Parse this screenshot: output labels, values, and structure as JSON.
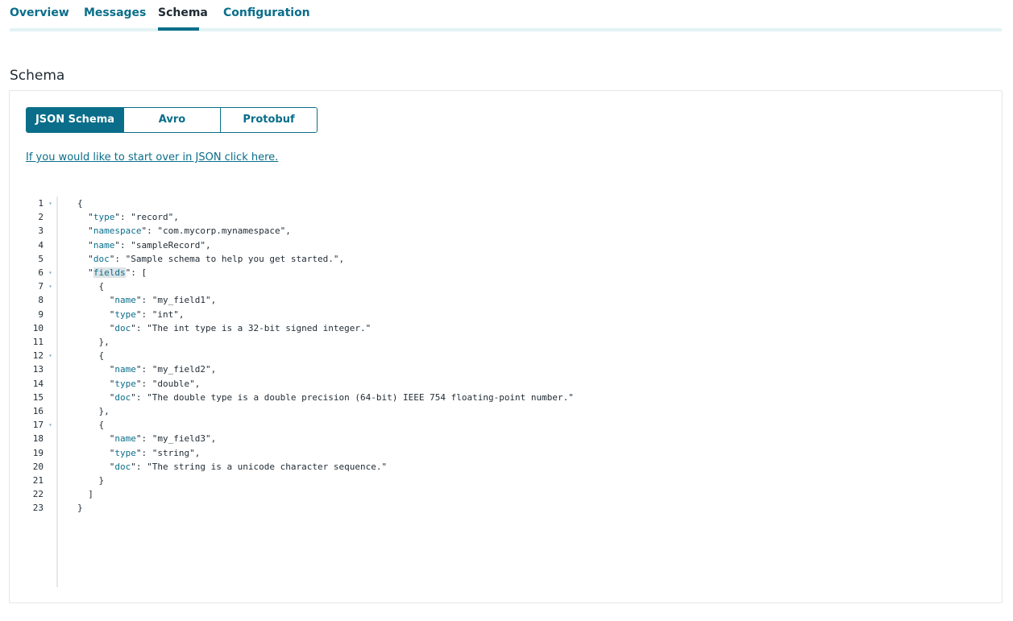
{
  "tabs": [
    {
      "label": "Overview"
    },
    {
      "label": "Messages"
    },
    {
      "label": "Schema"
    },
    {
      "label": "Configuration"
    }
  ],
  "page_title": "Schema",
  "schema_types": [
    {
      "label": "JSON Schema",
      "active": true
    },
    {
      "label": "Avro",
      "active": false
    },
    {
      "label": "Protobuf",
      "active": false
    }
  ],
  "start_over_link": "If you would like to start over in JSON click here.",
  "colors": {
    "accent": "#0a6e8a",
    "tab_rail": "#e3f3f4"
  },
  "editor": {
    "lines": [
      {
        "n": "1",
        "fold": true,
        "pre": "{",
        "key": "",
        "post": ""
      },
      {
        "n": "2",
        "fold": false,
        "pre": "  \"",
        "key": "type",
        "post": "\": \"record\","
      },
      {
        "n": "3",
        "fold": false,
        "pre": "  \"",
        "key": "namespace",
        "post": "\": \"com.mycorp.mynamespace\","
      },
      {
        "n": "4",
        "fold": false,
        "pre": "  \"",
        "key": "name",
        "post": "\": \"sampleRecord\","
      },
      {
        "n": "5",
        "fold": false,
        "pre": "  \"",
        "key": "doc",
        "post": "\": \"Sample schema to help you get started.\","
      },
      {
        "n": "6",
        "fold": true,
        "pre": "  \"",
        "key": "fields",
        "post": "\": [",
        "highlight": true
      },
      {
        "n": "7",
        "fold": true,
        "pre": "    {",
        "key": "",
        "post": ""
      },
      {
        "n": "8",
        "fold": false,
        "pre": "      \"",
        "key": "name",
        "post": "\": \"my_field1\","
      },
      {
        "n": "9",
        "fold": false,
        "pre": "      \"",
        "key": "type",
        "post": "\": \"int\","
      },
      {
        "n": "10",
        "fold": false,
        "pre": "      \"",
        "key": "doc",
        "post": "\": \"The int type is a 32-bit signed integer.\""
      },
      {
        "n": "11",
        "fold": false,
        "pre": "    },",
        "key": "",
        "post": ""
      },
      {
        "n": "12",
        "fold": true,
        "pre": "    {",
        "key": "",
        "post": ""
      },
      {
        "n": "13",
        "fold": false,
        "pre": "      \"",
        "key": "name",
        "post": "\": \"my_field2\","
      },
      {
        "n": "14",
        "fold": false,
        "pre": "      \"",
        "key": "type",
        "post": "\": \"double\","
      },
      {
        "n": "15",
        "fold": false,
        "pre": "      \"",
        "key": "doc",
        "post": "\": \"The double type is a double precision (64-bit) IEEE 754 floating-point number.\""
      },
      {
        "n": "16",
        "fold": false,
        "pre": "    },",
        "key": "",
        "post": ""
      },
      {
        "n": "17",
        "fold": true,
        "pre": "    {",
        "key": "",
        "post": ""
      },
      {
        "n": "18",
        "fold": false,
        "pre": "      \"",
        "key": "name",
        "post": "\": \"my_field3\","
      },
      {
        "n": "19",
        "fold": false,
        "pre": "      \"",
        "key": "type",
        "post": "\": \"string\","
      },
      {
        "n": "20",
        "fold": false,
        "pre": "      \"",
        "key": "doc",
        "post": "\": \"The string is a unicode character sequence.\""
      },
      {
        "n": "21",
        "fold": false,
        "pre": "    }",
        "key": "",
        "post": ""
      },
      {
        "n": "22",
        "fold": false,
        "pre": "  ]",
        "key": "",
        "post": ""
      },
      {
        "n": "23",
        "fold": false,
        "pre": "}",
        "key": "",
        "post": ""
      }
    ]
  }
}
